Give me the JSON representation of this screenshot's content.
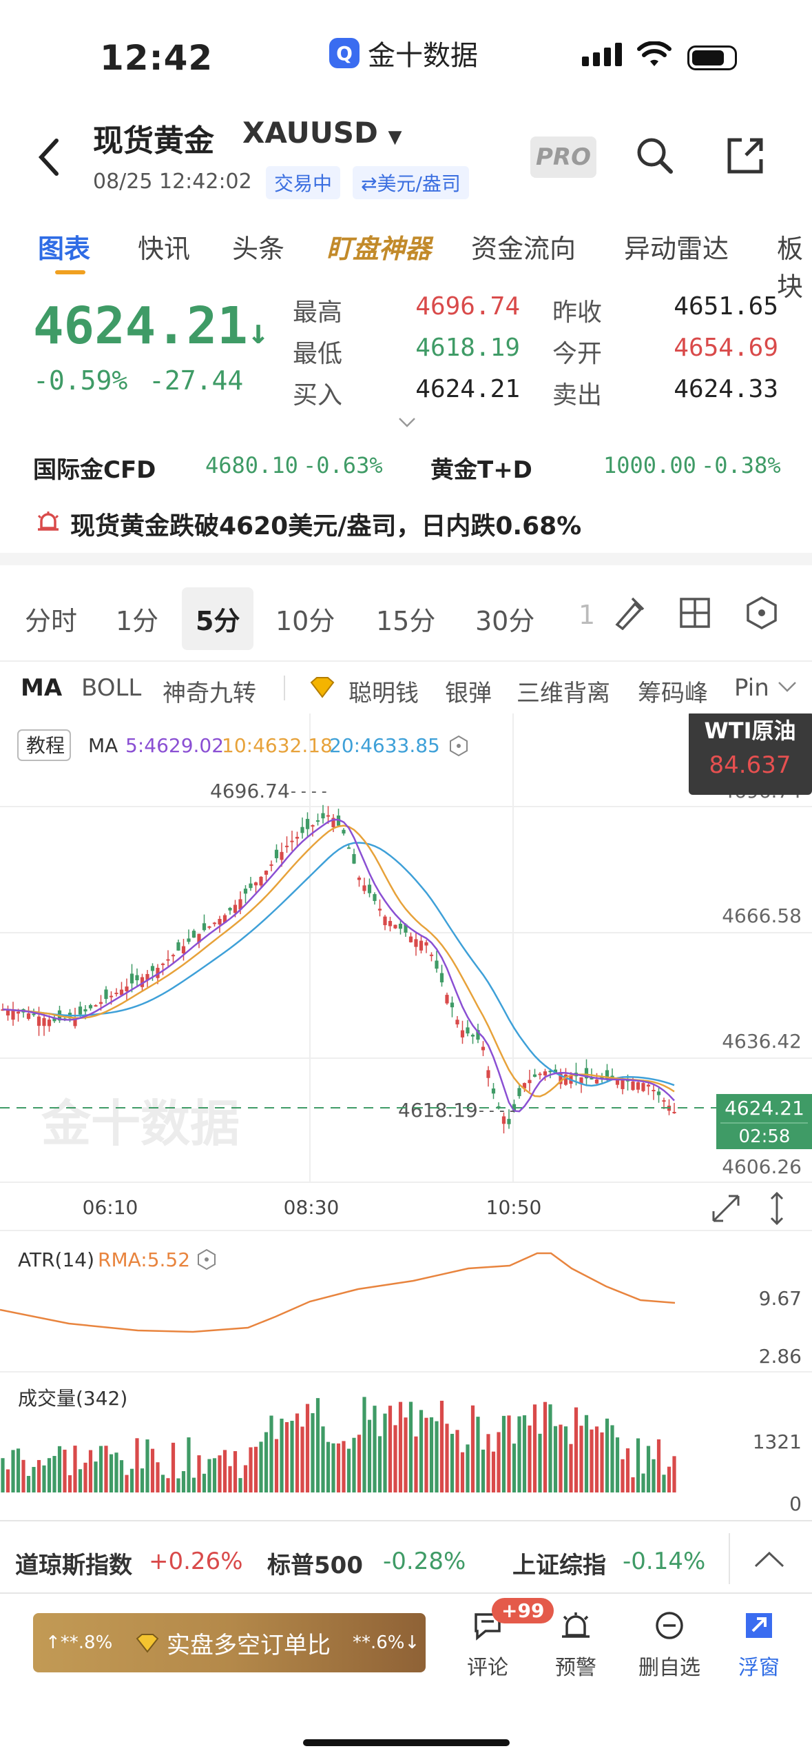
{
  "status_bar": {
    "time": "12:42",
    "app_name": "金十数据"
  },
  "header": {
    "title": "现货黄金",
    "symbol": "XAUUSD",
    "datetime": "08/25 12:42:02",
    "tag_trading": "交易中",
    "tag_unit": "⇄美元/盎司",
    "pro": "PRO"
  },
  "tabs": [
    "图表",
    "快讯",
    "头条",
    "盯盘神器",
    "资金流向",
    "异动雷达",
    "板块"
  ],
  "quote": {
    "price": "4624.21",
    "arrow": "↓",
    "pct": "-0.59%",
    "chg": "-27.44",
    "high_label": "最高",
    "high": "4696.74",
    "low_label": "最低",
    "low": "4618.19",
    "bid_label": "买入",
    "bid": "4624.21",
    "prev_label": "昨收",
    "prev": "4651.65",
    "open_label": "今开",
    "open": "4654.69",
    "ask_label": "卖出",
    "ask": "4624.33"
  },
  "related": [
    {
      "name": "国际金CFD",
      "price": "4680.10",
      "pct": "-0.63%"
    },
    {
      "name": "黄金T+D",
      "price": "1000.00",
      "pct": "-0.38%"
    }
  ],
  "alert": "现货黄金跌破4620美元/盎司，日内跌0.68%",
  "periods": [
    "分时",
    "1分",
    "5分",
    "10分",
    "15分",
    "30分",
    "1"
  ],
  "indicators": [
    "MA",
    "BOLL",
    "神奇九转",
    "聪明钱",
    "银弹",
    "三维背离",
    "筹码峰",
    "Pin"
  ],
  "chart_data": {
    "type": "candlestick",
    "tutorial": "教程",
    "ma_label": "MA",
    "ma5": "5:4629.02",
    "ma10": "10:4632.18",
    "ma20": "20:4633.85",
    "y_ticks": [
      "4696.74",
      "4666.58",
      "4636.42",
      "4606.26"
    ],
    "x_ticks": [
      "06:10",
      "08:30",
      "10:50"
    ],
    "high_mark": "4696.74",
    "low_mark": "4618.19",
    "last_price": "4624.21",
    "countdown": "02:58",
    "wti_label": "WTI原油",
    "wti_price": "84.637",
    "watermark": "金十数据",
    "atr_label": "ATR(14)",
    "atr_rma": "RMA:5.52",
    "atr_ticks": [
      "9.67",
      "2.86"
    ],
    "vol_label": "成交量(342)",
    "vol_ticks": [
      "1321",
      "0"
    ]
  },
  "indices": [
    {
      "name": "道琼斯指数",
      "pct": "+0.26%"
    },
    {
      "name": "标普500",
      "pct": "-0.28%"
    },
    {
      "name": "上证综指",
      "pct": "-0.14%"
    }
  ],
  "bottom": {
    "long_pct": "↑**.8%",
    "ratio_label": "实盘多空订单比",
    "short_pct": "**.6%↓",
    "badge": "+99",
    "nav": [
      "评论",
      "预警",
      "删自选",
      "浮窗"
    ]
  },
  "colors": {
    "up": "#d94a4a",
    "down": "#3f9b66",
    "accent": "#2f6ce5"
  }
}
